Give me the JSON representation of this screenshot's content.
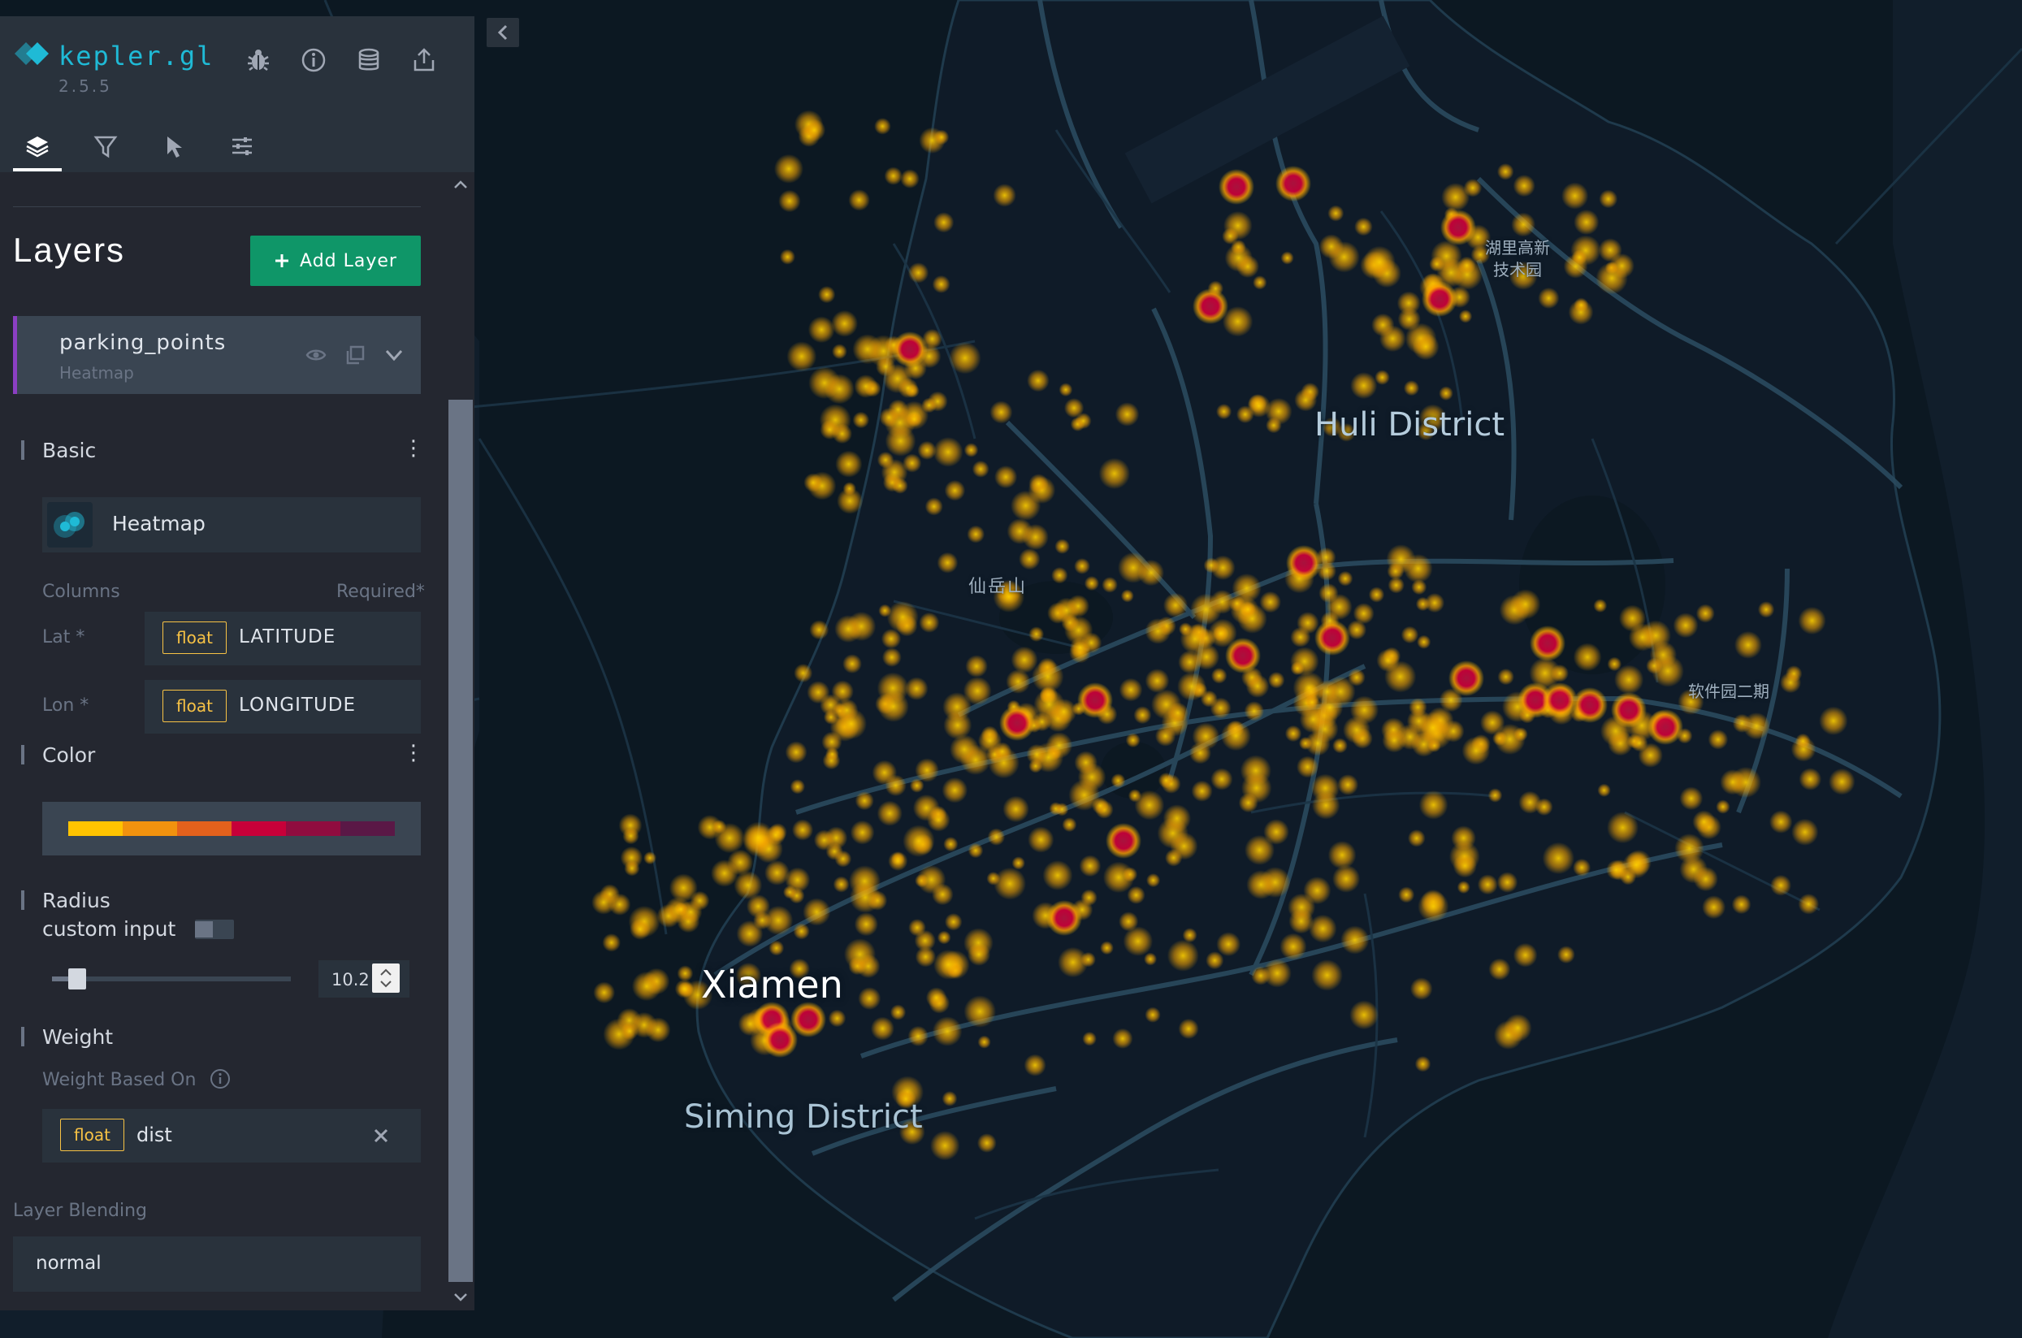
{
  "app": {
    "title": "kepler.gl",
    "version": "2.5.5",
    "accent_color": "#1fbad6",
    "header_icons": [
      "bug-icon",
      "info-icon",
      "database-icon",
      "share-icon"
    ]
  },
  "tabs": [
    {
      "name": "layers",
      "icon": "layers-icon",
      "active": true
    },
    {
      "name": "filters",
      "icon": "filter-icon",
      "active": false
    },
    {
      "name": "interactions",
      "icon": "cursor-icon",
      "active": false
    },
    {
      "name": "base-map",
      "icon": "sliders-icon",
      "active": false
    }
  ],
  "layers_panel": {
    "title": "Layers",
    "add_layer_label": "Add Layer",
    "layer": {
      "name": "parking_points",
      "type_label": "Heatmap",
      "color": "#8b3fc2"
    },
    "basic": {
      "title": "Basic",
      "layer_type": "Heatmap",
      "columns_label": "Columns",
      "required_label": "Required*",
      "lat_label": "Lat *",
      "lat_type": "float",
      "lat_column": "LATITUDE",
      "lon_label": "Lon *",
      "lon_type": "float",
      "lon_column": "LONGITUDE"
    },
    "color": {
      "title": "Color",
      "range": [
        "#ffc300",
        "#f1920e",
        "#e3611c",
        "#c70039",
        "#900c3f",
        "#5a1846"
      ]
    },
    "radius": {
      "title": "Radius",
      "custom_input_label": "custom input",
      "custom_input_enabled": false,
      "value": "10.2",
      "slider_fraction": 0.1
    },
    "weight": {
      "title": "Weight",
      "based_on_label": "Weight Based On",
      "field_type": "float",
      "field_name": "dist"
    },
    "blending": {
      "label": "Layer Blending",
      "value": "normal"
    }
  },
  "map": {
    "labels": {
      "xiamen": "Xiamen",
      "huli": "Huli District",
      "siming": "Siming District",
      "xianyue": "仙岳山",
      "ruanjian": "软件园二期",
      "huli_cn_1": "湖里高新",
      "huli_cn_2": "技术园"
    },
    "background": "#0e1a26"
  }
}
